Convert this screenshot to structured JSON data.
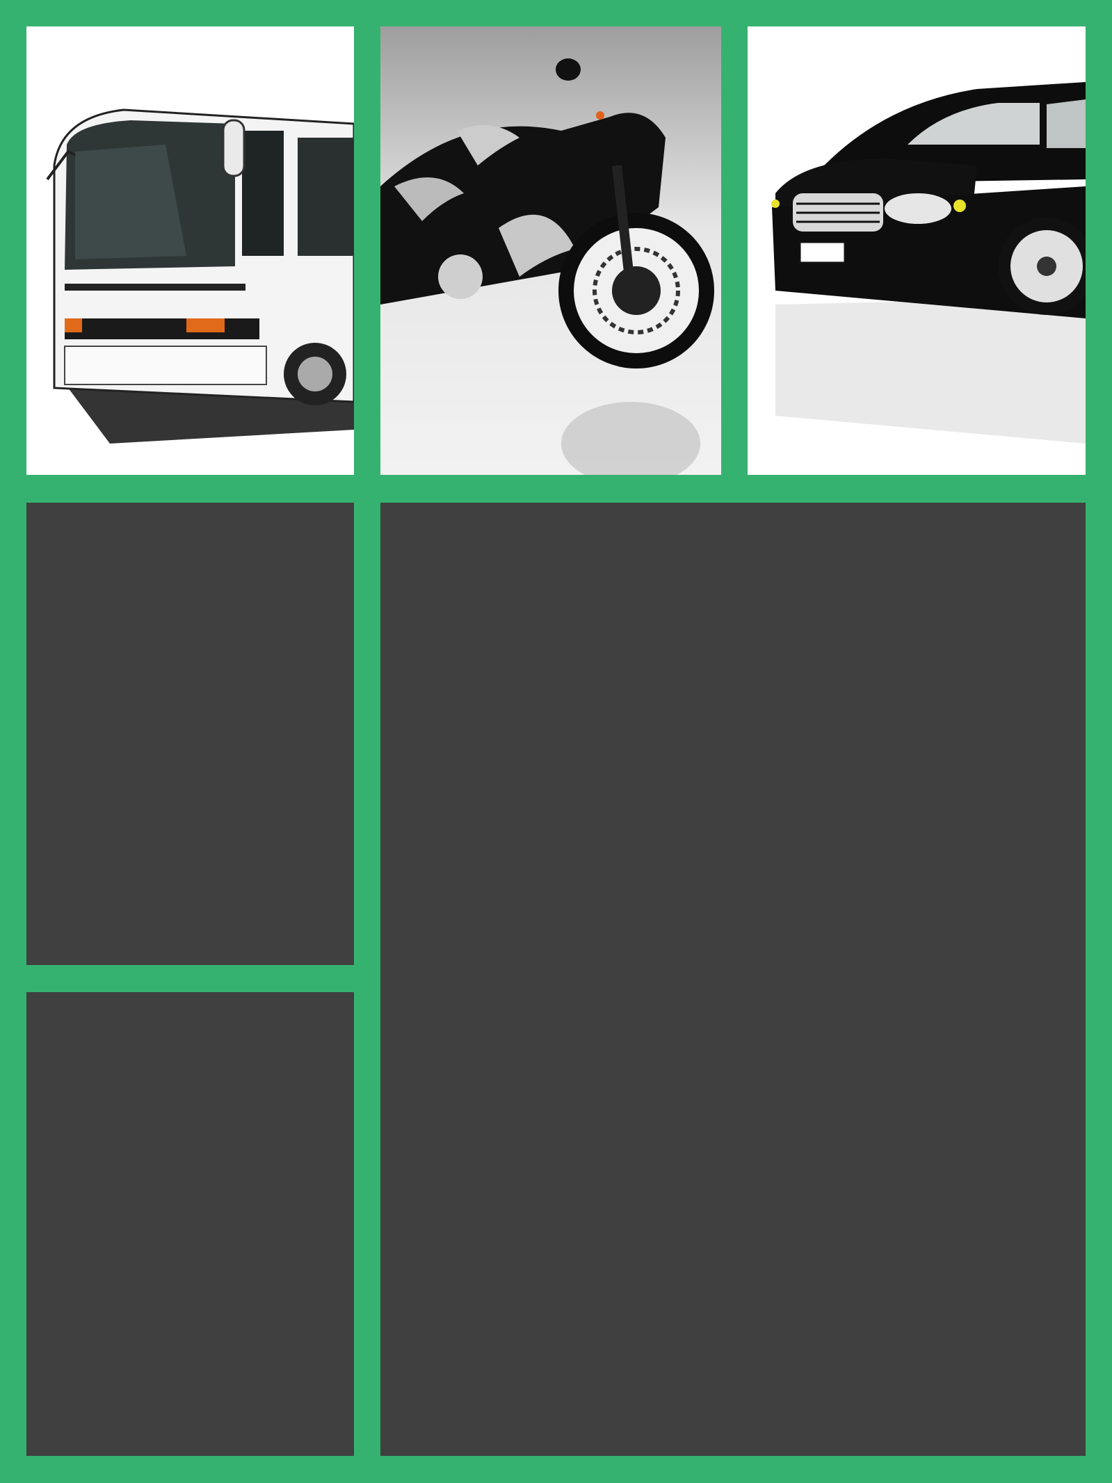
{
  "colors": {
    "background": "#36b270",
    "panel": "#404040",
    "tile_white": "#ffffff"
  },
  "tiles": [
    {
      "name": "bus",
      "icon": "bus-photo"
    },
    {
      "name": "motorcycle",
      "icon": "motorcycle-photo"
    },
    {
      "name": "car",
      "icon": "car-photo"
    }
  ],
  "panels": [
    {
      "name": "left-upper-panel"
    },
    {
      "name": "left-lower-panel"
    },
    {
      "name": "main-panel"
    }
  ]
}
